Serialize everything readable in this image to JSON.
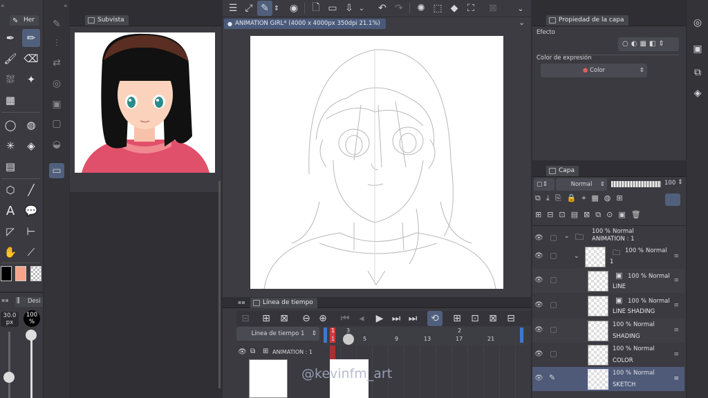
{
  "left_dock": {
    "tool_tab_label": "Her",
    "sub_tool_tab_label": "Desi",
    "brush_size_value": "30.0",
    "brush_size_unit": "px",
    "opacity_value": "100",
    "opacity_unit": "%",
    "main_color": "#000000",
    "sub_color": "#f4a48a"
  },
  "subview": {
    "tab_label": "Subvista"
  },
  "canvas": {
    "tab_label": "ANIMATION GIRL* (4000 x 4000px 350dpi 21.1%)"
  },
  "layer_property": {
    "tab_label": "Propiedad de la capa",
    "effect_label": "Efecto",
    "expression_color_label": "Color de expresión",
    "expression_color_value": "Color"
  },
  "layers_panel": {
    "tab_label": "Capa",
    "blend_mode": "Normal",
    "opacity": "100",
    "layers": [
      {
        "pct": "100 %",
        "mode": "Normal",
        "name": "ANIMATION : 1",
        "kind": "folder-root"
      },
      {
        "pct": "100 %",
        "mode": "Normal",
        "name": "1",
        "kind": "folder"
      },
      {
        "pct": "100 %",
        "mode": "Normal",
        "name": "LINE",
        "kind": "raster"
      },
      {
        "pct": "100 %",
        "mode": "Normal",
        "name": "LINE SHADING",
        "kind": "raster"
      },
      {
        "pct": "100 %",
        "mode": "Normal",
        "name": "SHADING",
        "kind": "raster"
      },
      {
        "pct": "100 %",
        "mode": "Normal",
        "name": "COLOR",
        "kind": "raster"
      },
      {
        "pct": "100 %",
        "mode": "Normal",
        "name": "SKETCH",
        "kind": "raster",
        "selected": true
      }
    ]
  },
  "timeline": {
    "tab_label": "Línea de tiempo",
    "timeline_name": "Línea de tiempo 1",
    "track_label": "ANIMATION : 1",
    "ruler_top": [
      "1",
      "3"
    ],
    "ruler_bottom": [
      "1",
      "5",
      "9",
      "13",
      "17",
      "21"
    ],
    "ruler_top_right": "2"
  },
  "watermark": "@kevinfm_art",
  "colors": {
    "accent": "#50607c",
    "selected_layer": "#4e5a78",
    "timeline_playhead": "#d23a3a",
    "timeline_range": "#3a7acc"
  }
}
